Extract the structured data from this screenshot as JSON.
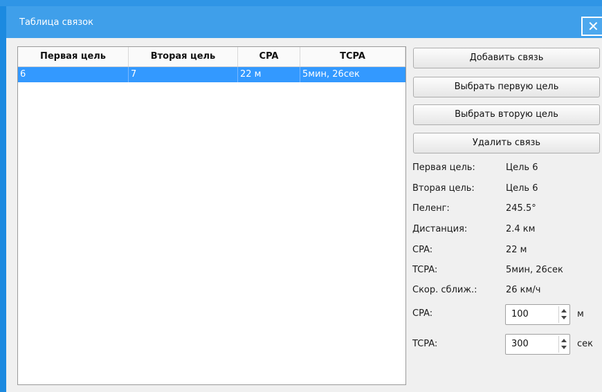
{
  "window": {
    "title": "Таблица связок",
    "close_glyph": "✕"
  },
  "table": {
    "columns": [
      "Первая цель",
      "Вторая цель",
      "CPA",
      "TCPA"
    ],
    "rows": [
      {
        "first": "6",
        "second": "7",
        "cpa": "22 м",
        "tcpa": "5мин, 26сек"
      }
    ],
    "selected_row": 0,
    "selection_color": "#3399ff"
  },
  "buttons": {
    "add_link": "Добавить связь",
    "select_first": "Выбрать первую цель",
    "select_second": "Выбрать вторую цель",
    "delete_link": "Удалить связь"
  },
  "info": {
    "first_target_label": "Первая цель:",
    "first_target_value": "Цель 6",
    "second_target_label": "Вторая цель:",
    "second_target_value": "Цель 6",
    "bearing_label": "Пеленг:",
    "bearing_value": "245.5°",
    "distance_label": "Дистанция:",
    "distance_value": "2.4 км",
    "cpa_label": "CPA:",
    "cpa_value": "22 м",
    "tcpa_label": "TCPA:",
    "tcpa_value": "5мин, 26сек",
    "speed_label": "Скор. сближ.:",
    "speed_value": "26 км/ч"
  },
  "thresholds": {
    "cpa_label": "CPA:",
    "cpa_value": "100",
    "cpa_unit": "м",
    "tcpa_label": "TCPA:",
    "tcpa_value": "300",
    "tcpa_unit": "сек"
  },
  "colors": {
    "titlebar": "#3f9fea",
    "accent": "#1c8ae0"
  }
}
